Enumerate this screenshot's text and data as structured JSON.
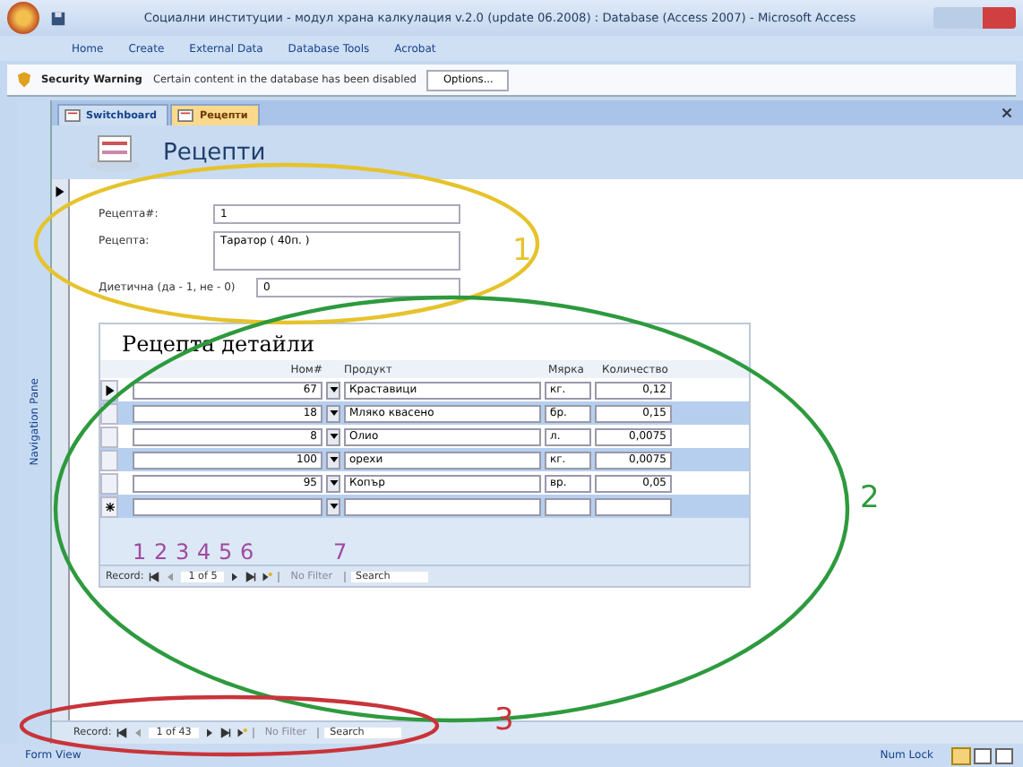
{
  "window": {
    "title": "Социални институции - модул храна калкулация v.2.0 (update 06.2008) : Database (Access 2007) - Microsoft Access"
  },
  "ribbon_tabs": [
    "Home",
    "Create",
    "External Data",
    "Database Tools",
    "Acrobat"
  ],
  "security_bar": {
    "title": "Security Warning",
    "message": "Certain content in the database has been disabled",
    "button": "Options..."
  },
  "document_tabs": [
    {
      "label": "Switchboard",
      "selected": false
    },
    {
      "label": "Рецепти",
      "selected": true
    }
  ],
  "navigation_pane": {
    "label": "Navigation Pane"
  },
  "form": {
    "title": "Рецепти",
    "fields": [
      {
        "label": "Рецепта#:",
        "value": "1",
        "tall": false
      },
      {
        "label": "Рецепта:",
        "value": "Таратор ( 40п. )",
        "tall": true
      },
      {
        "label": "Диетична (да - 1, не - 0)",
        "value": "0",
        "tall": false
      }
    ],
    "subform": {
      "title": "Рецепта детайли",
      "columns": [
        "Ном#",
        "Продукт",
        "Мярка",
        "Количество"
      ],
      "rows": [
        {
          "number": "67",
          "product": "Краставици",
          "unit": "кг.",
          "quantity": "0,12",
          "current": true
        },
        {
          "number": "18",
          "product": "Мляко квасено",
          "unit": "бр.",
          "quantity": "0,15",
          "current": false
        },
        {
          "number": "8",
          "product": "Олио",
          "unit": "л.",
          "quantity": "0,0075",
          "current": false
        },
        {
          "number": "100",
          "product": "орехи",
          "unit": "кг.",
          "quantity": "0,0075",
          "current": false
        },
        {
          "number": "95",
          "product": "Копър",
          "unit": "вр.",
          "quantity": "0,05",
          "current": false
        }
      ],
      "navigator": {
        "label": "Record:",
        "position": "1 of 5",
        "filter": "No Filter",
        "search": "Search"
      }
    },
    "navigator": {
      "label": "Record:",
      "position": "1 of 43",
      "filter": "No Filter",
      "search": "Search"
    }
  },
  "annotations": [
    {
      "label": "1",
      "color": "#e6c32c"
    },
    {
      "label": "2",
      "color": "#2e9a3e"
    },
    {
      "label": "3",
      "color": "#c8343a"
    }
  ],
  "button_marks": {
    "color": "#a04aa0",
    "labels": [
      "1",
      "2",
      "3",
      "4",
      "5",
      "6",
      "7"
    ]
  },
  "status_bar": {
    "left": "Form View",
    "right": "Num Lock"
  }
}
